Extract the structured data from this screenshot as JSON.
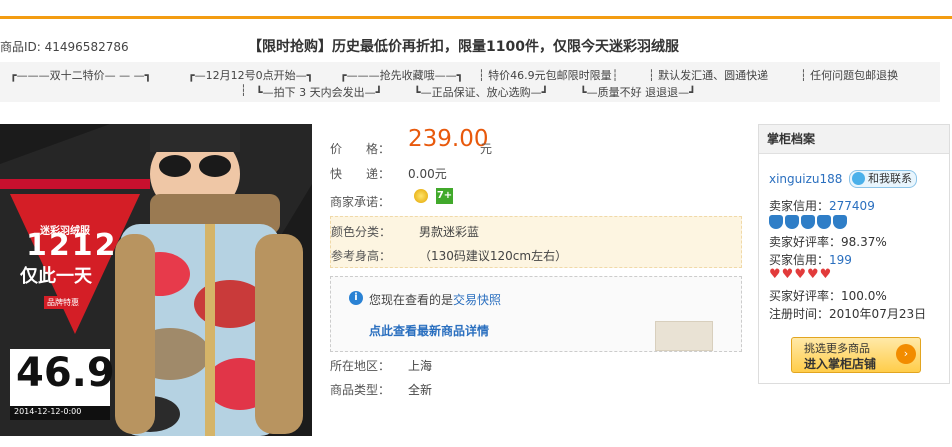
{
  "header": {
    "product_id": "商品ID: 41496582786",
    "title": "【限时抢购】历史最低价再折扣，限量1100件，仅限今天迷彩羽绒服"
  },
  "tags": {
    "row1": [
      "┏———双十二特价— — —┓",
      "┏—12月12号0点开始—┓",
      "┏———抢先收藏哦——┓",
      "┆ 特价46.9元包邮限时限量┆",
      "┆ 默认发汇通、圆通快递",
      "┆ 任何问题包邮退换"
    ],
    "row2": [
      "┆",
      "┗—拍下 3 天内会发出—┛",
      "┗—正品保证、放心选购—┛",
      "┗—质量不好 退退退—┛"
    ]
  },
  "banner": {
    "subtitle": "迷彩羽绒服",
    "big": "1212",
    "slogan": "仅此一天",
    "badge": "品牌特惠",
    "price": "46.9",
    "date": "2014-12-12-0:00"
  },
  "details": {
    "price_label": "价　　格：",
    "price": "239.00",
    "price_unit": "元",
    "shipping_label": "快　　递：",
    "shipping": "0.00元",
    "promise_label": "商家承诺：",
    "promise_badge": "7+",
    "color_label": "颜色分类：",
    "color": "男款迷彩蓝",
    "height_label": "参考身高：",
    "height": "（130码建议120cm左右）",
    "notice_prefix": "您现在查看的是",
    "notice_link": "交易快照",
    "detail_link": "点此查看最新商品详情",
    "region_label": "所在地区：",
    "region": "上海",
    "type_label": "商品类型：",
    "type": "全新"
  },
  "seller": {
    "head": "掌柜档案",
    "name": "xinguizu188",
    "contact": "和我联系",
    "seller_credit_label": "卖家信用：",
    "seller_credit": "277409",
    "seller_rate_label": "卖家好评率：",
    "seller_rate": "98.37%",
    "buyer_credit_label": "买家信用：",
    "buyer_credit": "199",
    "buyer_rate_label": "买家好评率：",
    "buyer_rate": "100.0%",
    "reg_label": "注册时间：",
    "reg_date": "2010年07月23日",
    "btn_top": "挑选更多商品",
    "btn_bottom": "进入掌柜店铺"
  },
  "colors": {
    "accent": "#f39c12",
    "price": "#e8590c",
    "link": "#2a6fbf"
  }
}
